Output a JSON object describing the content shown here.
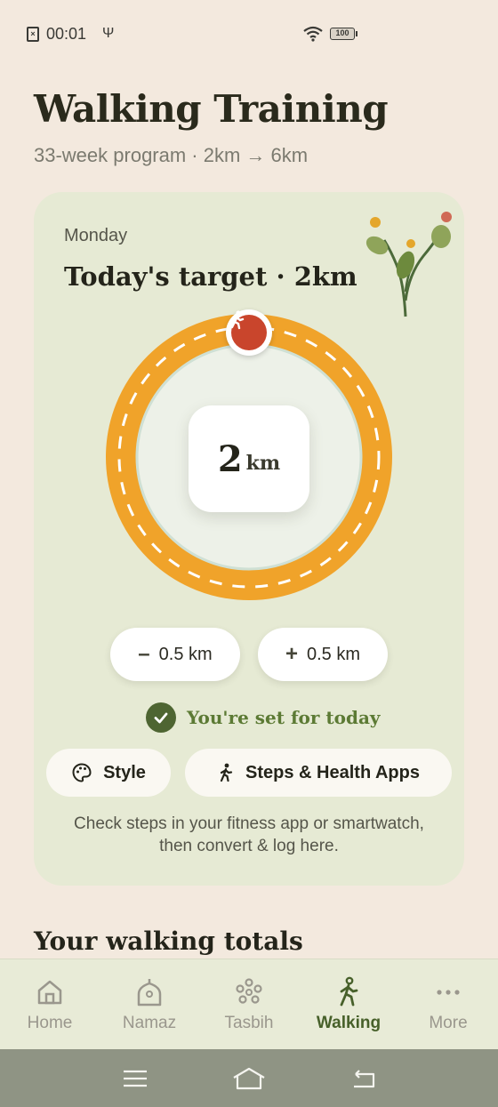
{
  "status": {
    "time": "00:01",
    "battery": "100",
    "icons": [
      "sim-icon",
      "usb-icon",
      "wifi-icon",
      "battery-icon"
    ]
  },
  "header": {
    "title": "Walking Training",
    "subtitle": "33-week program · 2km → 6km"
  },
  "today": {
    "day": "Monday",
    "target_title": "Today's target · 2km",
    "km_value": "2",
    "km_unit": "km",
    "minus_label": "0.5 km",
    "plus_label": "0.5 km",
    "set_message": "You're set for today",
    "style_label": "Style",
    "steps_label": "Steps & Health Apps",
    "note": "Check steps in your fitness app or smartwatch, then convert & log here."
  },
  "totals": {
    "title": "Your walking totals"
  },
  "nav": {
    "items": [
      {
        "label": "Home",
        "icon": "home-icon"
      },
      {
        "label": "Namaz",
        "icon": "namaz-icon"
      },
      {
        "label": "Tasbih",
        "icon": "tasbih-icon"
      },
      {
        "label": "Walking",
        "icon": "walking-icon",
        "active": true
      },
      {
        "label": "More",
        "icon": "more-icon"
      }
    ]
  },
  "colors": {
    "accent": "#47602a",
    "ring": "#f0a32a",
    "badge": "#c9452c",
    "card": "#e6ead4",
    "background": "#f3e9de"
  }
}
